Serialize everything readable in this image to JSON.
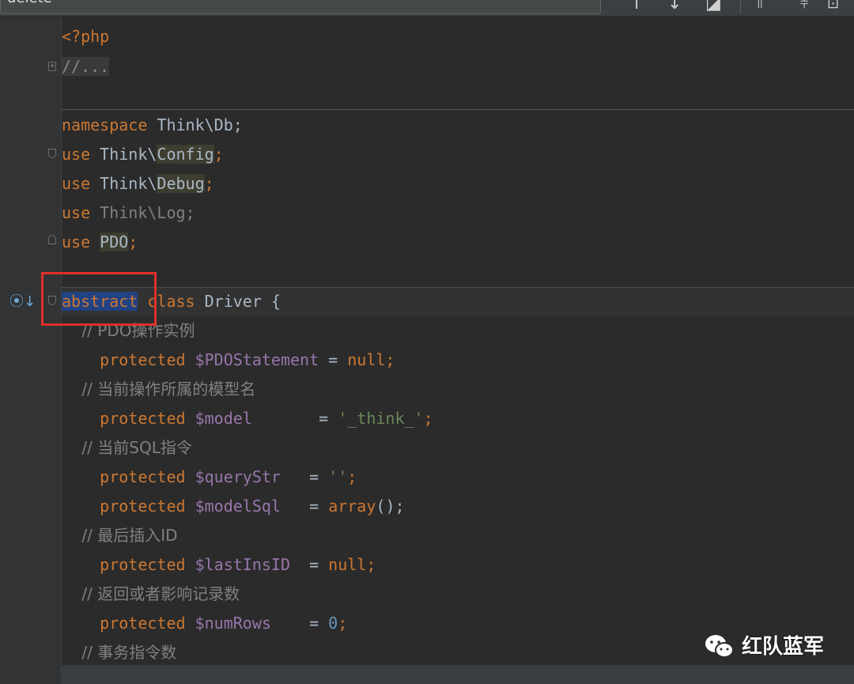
{
  "find": {
    "query": "delete",
    "icons": [
      "return-icon",
      "close-icon",
      "arrow-up-icon",
      "arrow-down-icon",
      "select-all-icon",
      "filter-icon",
      "filter2-icon",
      "options-icon"
    ]
  },
  "code": {
    "l1": "<?php",
    "l2": "//...",
    "l3_kw": "namespace",
    "l3_rest": " Think\\Db;",
    "use": "use",
    "think": " Think\\",
    "config": "Config",
    "debug": "Debug",
    "log_line": " Think\\Log;",
    "pdo": "PDO",
    "semi": ";",
    "abstract": "abstract",
    "class": " class",
    "driver": " Driver {",
    "c1": "    // PDO操作实例",
    "protected": "protected",
    "v1": " $PDOStatement",
    "v1_eq": " = ",
    "null": "null",
    "c2": "    // 当前操作所属的模型名",
    "v2": " $model",
    "v2_eq": "       = ",
    "s2": "'_think_'",
    "c3": "    // 当前SQL指令",
    "v3": " $queryStr",
    "v3_eq": "   = ",
    "s3": "''",
    "v4": " $modelSql",
    "v4_eq": "   = ",
    "arr": "array",
    "arr_rest": "();",
    "c4": "    // 最后插入ID",
    "v5": " $lastInsID",
    "v5_eq": "  = ",
    "c5": "    // 返回或者影响记录数",
    "v6": " $numRows",
    "v6_eq": "    = ",
    "zero": "0",
    "c6": "    // 事务指令数"
  },
  "watermark": "红队蓝军"
}
